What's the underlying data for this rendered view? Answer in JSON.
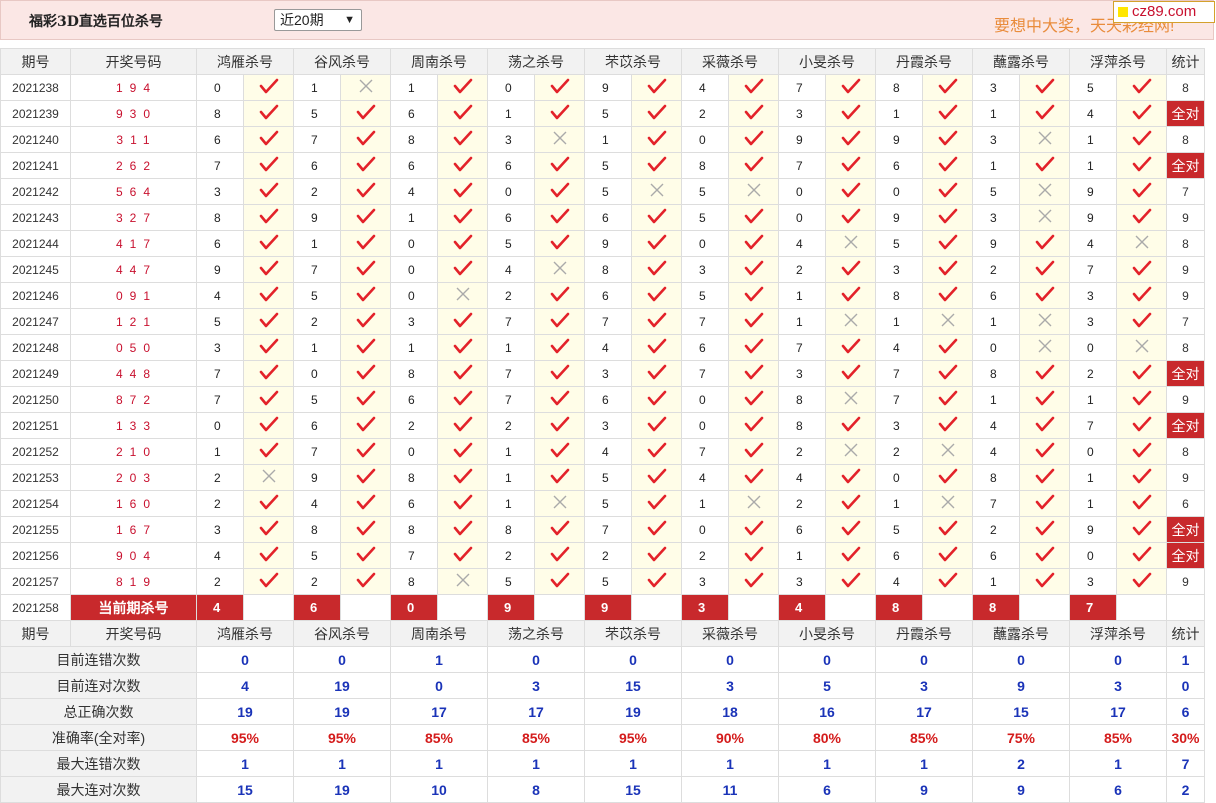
{
  "page": {
    "title": "福彩3D直选百位杀号",
    "period_select": "近20期",
    "slogan": "要想中大奖，天天彩经网!",
    "badge": "cz89.com"
  },
  "headers": {
    "period": "期号",
    "draw": "开奖号码",
    "experts": [
      "鸿雁杀号",
      "谷风杀号",
      "周南杀号",
      "荡之杀号",
      "芣苡杀号",
      "采薇杀号",
      "小旻杀号",
      "丹霞杀号",
      "蘸露杀号",
      "浮萍杀号"
    ],
    "stat": "统计"
  },
  "rows": [
    {
      "p": "2021238",
      "n": "194",
      "v": [
        0,
        1,
        1,
        0,
        9,
        4,
        7,
        8,
        3,
        5
      ],
      "r": "1011111111",
      "s": "8"
    },
    {
      "p": "2021239",
      "n": "930",
      "v": [
        8,
        5,
        6,
        1,
        5,
        2,
        3,
        1,
        1,
        4
      ],
      "r": "1111111111",
      "s": "全对"
    },
    {
      "p": "2021240",
      "n": "311",
      "v": [
        6,
        7,
        8,
        3,
        1,
        0,
        9,
        9,
        3,
        1
      ],
      "r": "1110111101",
      "s": "8"
    },
    {
      "p": "2021241",
      "n": "262",
      "v": [
        7,
        6,
        6,
        6,
        5,
        8,
        7,
        6,
        1,
        1
      ],
      "r": "1111111111",
      "s": "全对"
    },
    {
      "p": "2021242",
      "n": "564",
      "v": [
        3,
        2,
        4,
        0,
        5,
        5,
        0,
        0,
        5,
        9
      ],
      "r": "1111001101",
      "s": "7"
    },
    {
      "p": "2021243",
      "n": "327",
      "v": [
        8,
        9,
        1,
        6,
        6,
        5,
        0,
        9,
        3,
        9
      ],
      "r": "1111111101",
      "s": "9"
    },
    {
      "p": "2021244",
      "n": "417",
      "v": [
        6,
        1,
        0,
        5,
        9,
        0,
        4,
        5,
        9,
        4
      ],
      "r": "1111110110",
      "s": "8"
    },
    {
      "p": "2021245",
      "n": "447",
      "v": [
        9,
        7,
        0,
        4,
        8,
        3,
        2,
        3,
        2,
        7
      ],
      "r": "1110111111",
      "s": "9"
    },
    {
      "p": "2021246",
      "n": "091",
      "v": [
        4,
        5,
        0,
        2,
        6,
        5,
        1,
        8,
        6,
        3
      ],
      "r": "1101111111",
      "s": "9"
    },
    {
      "p": "2021247",
      "n": "121",
      "v": [
        5,
        2,
        3,
        7,
        7,
        7,
        1,
        1,
        1,
        3
      ],
      "r": "1111110001",
      "s": "7"
    },
    {
      "p": "2021248",
      "n": "050",
      "v": [
        3,
        1,
        1,
        1,
        4,
        6,
        7,
        4,
        0,
        0
      ],
      "r": "1111111100",
      "s": "8"
    },
    {
      "p": "2021249",
      "n": "448",
      "v": [
        7,
        0,
        8,
        7,
        3,
        7,
        3,
        7,
        8,
        2
      ],
      "r": "1111111111",
      "s": "全对"
    },
    {
      "p": "2021250",
      "n": "872",
      "v": [
        7,
        5,
        6,
        7,
        6,
        0,
        8,
        7,
        1,
        1
      ],
      "r": "1111110111",
      "s": "9"
    },
    {
      "p": "2021251",
      "n": "133",
      "v": [
        0,
        6,
        2,
        2,
        3,
        0,
        8,
        3,
        4,
        7
      ],
      "r": "1111111111",
      "s": "全对"
    },
    {
      "p": "2021252",
      "n": "210",
      "v": [
        1,
        7,
        0,
        1,
        4,
        7,
        2,
        2,
        4,
        0
      ],
      "r": "1111110011",
      "s": "8"
    },
    {
      "p": "2021253",
      "n": "203",
      "v": [
        2,
        9,
        8,
        1,
        5,
        4,
        4,
        0,
        8,
        1
      ],
      "r": "0111111111",
      "s": "9"
    },
    {
      "p": "2021254",
      "n": "160",
      "v": [
        2,
        4,
        6,
        1,
        5,
        1,
        2,
        1,
        7,
        1
      ],
      "r": "1110101011",
      "s": "6"
    },
    {
      "p": "2021255",
      "n": "167",
      "v": [
        3,
        8,
        8,
        8,
        7,
        0,
        6,
        5,
        2,
        9
      ],
      "r": "1111111111",
      "s": "全对"
    },
    {
      "p": "2021256",
      "n": "904",
      "v": [
        4,
        5,
        7,
        2,
        2,
        2,
        1,
        6,
        6,
        0
      ],
      "r": "1111111111",
      "s": "全对"
    },
    {
      "p": "2021257",
      "n": "819",
      "v": [
        2,
        2,
        8,
        5,
        5,
        3,
        3,
        4,
        1,
        3
      ],
      "r": "1101111111",
      "s": "9"
    }
  ],
  "current": {
    "period": "2021258",
    "label": "当前期杀号",
    "values": [
      "4",
      "6",
      "0",
      "9",
      "9",
      "3",
      "4",
      "8",
      "8",
      "7"
    ]
  },
  "stats": [
    {
      "label": "目前连错次数",
      "vals": [
        "0",
        "0",
        "1",
        "0",
        "0",
        "0",
        "0",
        "0",
        "0",
        "0"
      ],
      "total": "1",
      "pct": false
    },
    {
      "label": "目前连对次数",
      "vals": [
        "4",
        "19",
        "0",
        "3",
        "15",
        "3",
        "5",
        "3",
        "9",
        "3"
      ],
      "total": "0",
      "pct": false
    },
    {
      "label": "总正确次数",
      "vals": [
        "19",
        "19",
        "17",
        "17",
        "19",
        "18",
        "16",
        "17",
        "15",
        "17"
      ],
      "total": "6",
      "pct": false
    },
    {
      "label": "准确率(全对率)",
      "vals": [
        "95%",
        "95%",
        "85%",
        "85%",
        "95%",
        "90%",
        "80%",
        "85%",
        "75%",
        "85%"
      ],
      "total": "30%",
      "pct": true
    },
    {
      "label": "最大连错次数",
      "vals": [
        "1",
        "1",
        "1",
        "1",
        "1",
        "1",
        "1",
        "1",
        "2",
        "1"
      ],
      "total": "7",
      "pct": false
    },
    {
      "label": "最大连对次数",
      "vals": [
        "15",
        "19",
        "10",
        "8",
        "15",
        "11",
        "6",
        "9",
        "9",
        "6"
      ],
      "total": "2",
      "pct": false
    }
  ],
  "icons": {
    "correct": "check-icon",
    "wrong": "cross-icon"
  },
  "colors": {
    "accent_red": "#c8292c",
    "check_red": "#e3222a",
    "stat_blue": "#1a33b8",
    "header_bg": "#fbe7e5"
  }
}
